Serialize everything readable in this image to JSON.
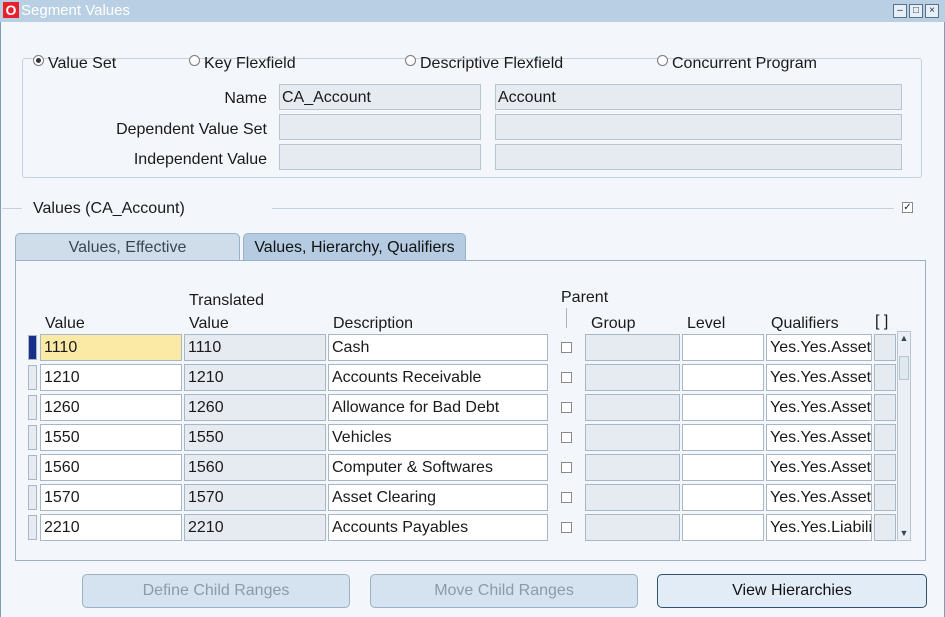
{
  "window": {
    "title": "Segment Values"
  },
  "radios": [
    {
      "label": "Value Set",
      "selected": true
    },
    {
      "label": "Key Flexfield",
      "selected": false
    },
    {
      "label": "Descriptive Flexfield",
      "selected": false
    },
    {
      "label": "Concurrent Program",
      "selected": false
    }
  ],
  "fields": {
    "name_label": "Name",
    "name_value": "CA_Account",
    "name_desc": "Account",
    "dependent_label": "Dependent Value Set",
    "independent_label": "Independent Value"
  },
  "values_section": {
    "title": "Values (CA_Account)"
  },
  "tabs": [
    {
      "label": "Values, Effective",
      "active": false
    },
    {
      "label": "Values, Hierarchy, Qualifiers",
      "active": true
    }
  ],
  "headers": {
    "value": "Value",
    "translated_top": "Translated",
    "translated_bottom": "Value",
    "description": "Description",
    "parent": "Parent",
    "group": "Group",
    "level": "Level",
    "qualifiers": "Qualifiers",
    "brackets": "[ ]"
  },
  "rows": [
    {
      "value": "1110",
      "translated": "1110",
      "description": "Cash",
      "qualifiers": "Yes.Yes.Asset"
    },
    {
      "value": "1210",
      "translated": "1210",
      "description": "Accounts Receivable",
      "qualifiers": "Yes.Yes.Asset"
    },
    {
      "value": "1260",
      "translated": "1260",
      "description": "Allowance for Bad Debt",
      "qualifiers": "Yes.Yes.Asset"
    },
    {
      "value": "1550",
      "translated": "1550",
      "description": "Vehicles",
      "qualifiers": "Yes.Yes.Asset"
    },
    {
      "value": "1560",
      "translated": "1560",
      "description": "Computer & Softwares",
      "qualifiers": "Yes.Yes.Asset"
    },
    {
      "value": "1570",
      "translated": "1570",
      "description": "Asset Clearing",
      "qualifiers": "Yes.Yes.Asset"
    },
    {
      "value": "2210",
      "translated": "2210",
      "description": "Accounts Payables",
      "qualifiers": "Yes.Yes.Liability"
    }
  ],
  "buttons": {
    "define_child": "Define Child Ranges",
    "move_child": "Move Child Ranges",
    "view_hier": "View Hierarchies"
  },
  "colors": {
    "titlebar": "#b9cfe4",
    "highlight": "#fbeaa6",
    "accent": "#1a2f8a"
  }
}
